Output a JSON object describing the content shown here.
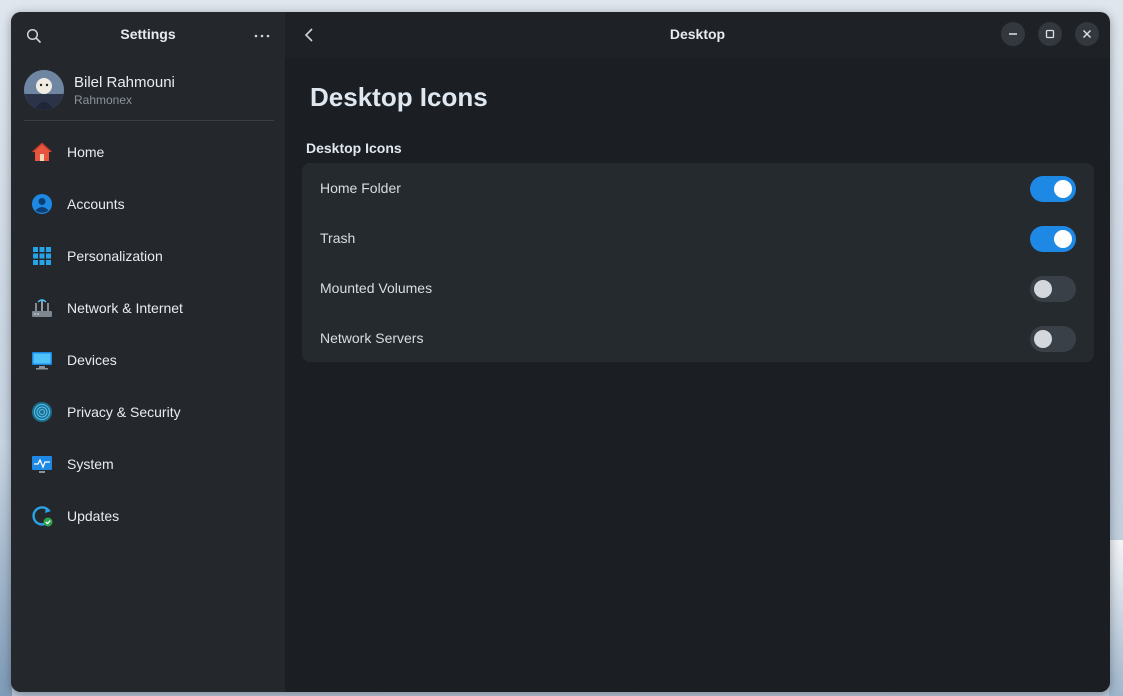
{
  "sidebar": {
    "title": "Settings",
    "search_icon": "search-icon",
    "menu_icon": "more-horizontal-icon",
    "user": {
      "name": "Bilel Rahmouni",
      "username": "Rahmonex"
    },
    "items": [
      {
        "label": "Home",
        "icon": "home-icon"
      },
      {
        "label": "Accounts",
        "icon": "user-icon"
      },
      {
        "label": "Personalization",
        "icon": "grid-icon"
      },
      {
        "label": "Network & Internet",
        "icon": "network-icon"
      },
      {
        "label": "Devices",
        "icon": "monitor-icon"
      },
      {
        "label": "Privacy & Security",
        "icon": "fingerprint-icon"
      },
      {
        "label": "System",
        "icon": "system-monitor-icon"
      },
      {
        "label": "Updates",
        "icon": "update-icon"
      }
    ]
  },
  "header": {
    "title": "Desktop"
  },
  "main": {
    "page_title": "Desktop Icons",
    "section_title": "Desktop Icons",
    "rows": [
      {
        "label": "Home Folder",
        "enabled": true
      },
      {
        "label": "Trash",
        "enabled": true
      },
      {
        "label": "Mounted Volumes",
        "enabled": false
      },
      {
        "label": "Network Servers",
        "enabled": false
      }
    ]
  },
  "colors": {
    "accent": "#1e88e5",
    "window_bg": "#1e2227",
    "sidebar_bg": "#24282d",
    "card_bg": "#252a2f"
  }
}
